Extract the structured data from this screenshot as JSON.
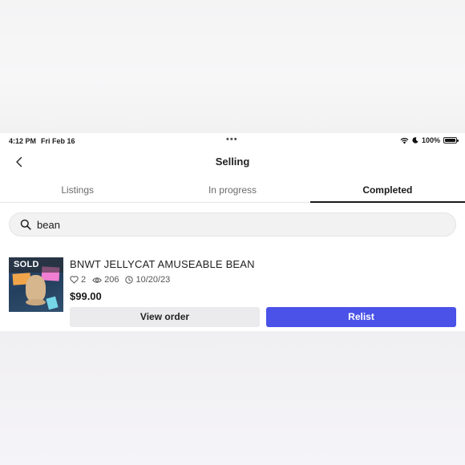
{
  "status_bar": {
    "time": "4:12 PM",
    "date": "Fri Feb 16",
    "battery": "100%"
  },
  "header": {
    "title": "Selling"
  },
  "tabs": [
    {
      "label": "Listings",
      "active": false
    },
    {
      "label": "In progress",
      "active": false
    },
    {
      "label": "Completed",
      "active": true
    }
  ],
  "search": {
    "value": "bean"
  },
  "listing": {
    "badge": "SOLD",
    "title": "BNWT JELLYCAT AMUSEABLE BEAN",
    "likes": "2",
    "views": "206",
    "date": "10/20/23",
    "price": "$99.00",
    "view_order_label": "View order",
    "relist_label": "Relist"
  },
  "colors": {
    "accent": "#4a52e8",
    "secondary_button": "#ebebee"
  }
}
